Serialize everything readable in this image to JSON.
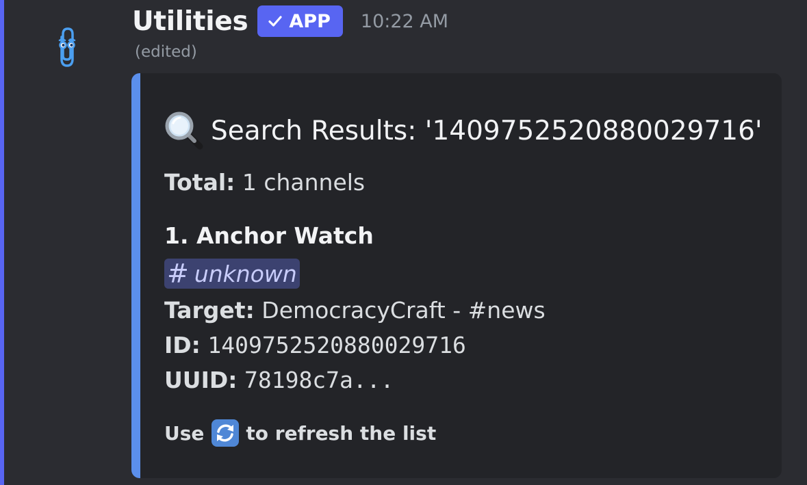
{
  "message": {
    "author": "Utilities",
    "app_tag": "APP",
    "timestamp": "10:22 AM",
    "edited_label": "(edited)",
    "avatar_icon": "paperclip-icon"
  },
  "embed": {
    "title_icon": "magnifying-glass-icon",
    "title": "Search Results: '1409752520880029716'",
    "total_label": "Total:",
    "total_value": "1 channels",
    "item_title": "1. Anchor Watch",
    "channel_hash": "#",
    "channel_name": "unknown",
    "target_label": "Target:",
    "target_value": "DemocracyCraft - #news",
    "id_label": "ID:",
    "id_value": "1409752520880029716",
    "uuid_label": "UUID:",
    "uuid_value": "78198c7a...",
    "footer_prefix": "Use",
    "footer_icon": "refresh-icon",
    "footer_suffix": "to refresh the list"
  },
  "colors": {
    "background": "#2b2c31",
    "embed_background": "#232428",
    "embed_stripe": "#5b8fec",
    "app_tag": "#5865f2",
    "mention_bar": "#5865f2",
    "channel_chip": "#3c4270"
  }
}
